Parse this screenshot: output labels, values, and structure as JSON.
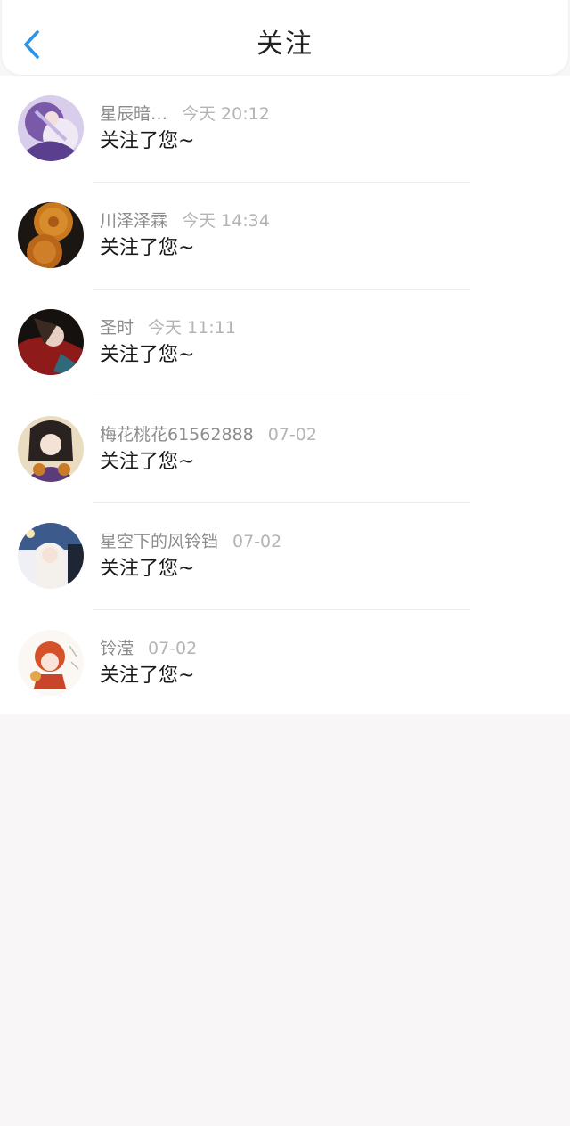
{
  "header": {
    "title": "关注",
    "back_icon": "chevron-left-icon",
    "accent_color": "#2b93e8"
  },
  "notifications": [
    {
      "name": "星辰暗…",
      "time": "今天 20:12",
      "message": "关注了您~"
    },
    {
      "name": "川泽泽霖",
      "time": "今天 14:34",
      "message": "关注了您~"
    },
    {
      "name": "圣时",
      "time": "今天 11:11",
      "message": "关注了您~"
    },
    {
      "name": "梅花桃花61562888",
      "time": "07-02",
      "message": "关注了您~"
    },
    {
      "name": "星空下的风铃铛",
      "time": "07-02",
      "message": "关注了您~"
    },
    {
      "name": "铃滢",
      "time": "07-02",
      "message": "关注了您~"
    }
  ]
}
